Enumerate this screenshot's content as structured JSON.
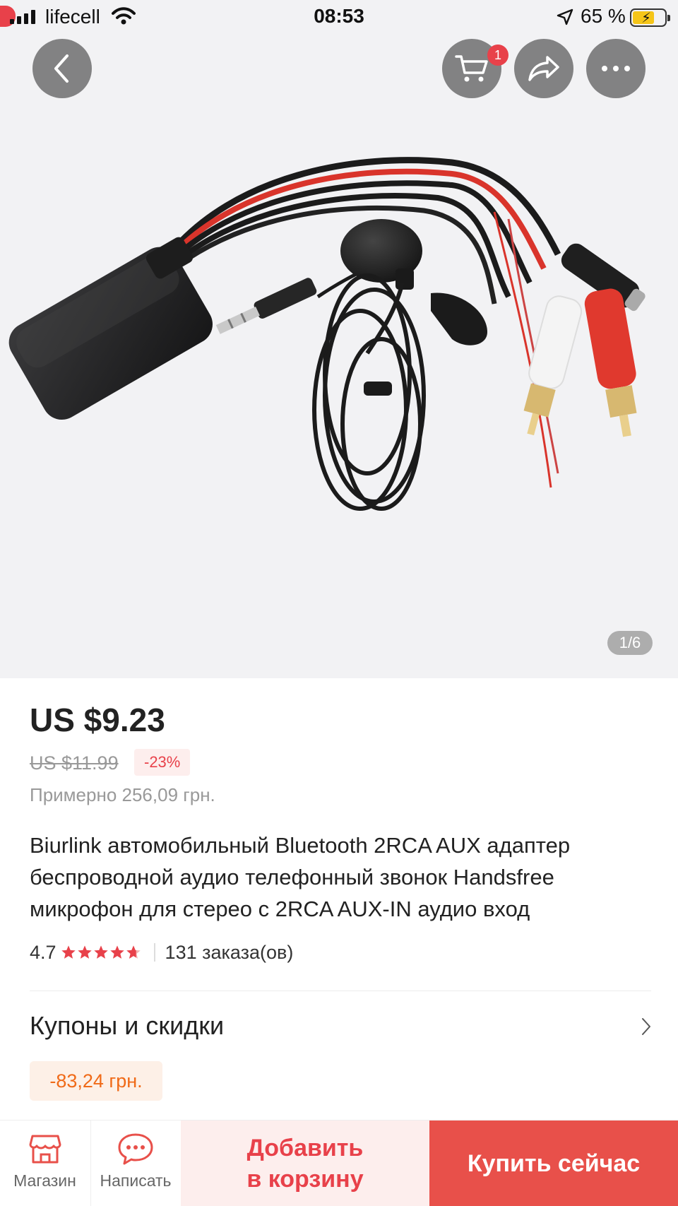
{
  "status_bar": {
    "carrier": "lifecell",
    "time": "08:53",
    "battery_percent": "65 %",
    "battery_level": 0.65,
    "icons": [
      "signal-icon",
      "wifi-icon",
      "location-arrow-icon",
      "battery-charging-icon"
    ]
  },
  "gallery": {
    "page_indicator": "1/6",
    "cart_count": "1",
    "icons": [
      "back-icon",
      "cart-icon",
      "share-icon",
      "more-icon"
    ]
  },
  "product": {
    "price": "US $9.23",
    "original_price": "US $11.99",
    "discount": "-23%",
    "approx_price": "Примерно 256,09 грн.",
    "title": "Biurlink автомобильный Bluetooth 2RCA AUX адаптер беспроводной аудио телефонный звонок Handsfree микрофон для стерео с 2RCA AUX-IN аудио вход",
    "rating": "4.7",
    "rating_value": 4.7,
    "rating_max": 5,
    "orders": "131 заказа(ов)"
  },
  "coupons": {
    "title": "Купоны и скидки",
    "coupon_value": "-83,24 грн."
  },
  "bottom_bar": {
    "store_label": "Магазин",
    "chat_label": "Написать",
    "add_to_cart_line1": "Добавить",
    "add_to_cart_line2": "в корзину",
    "buy_now_label": "Купить сейчас"
  },
  "colors": {
    "accent": "#e8504a",
    "badge": "#e8414a",
    "coupon_text": "#f06a18",
    "coupon_bg": "#fdf0e7",
    "add_to_cart_bg": "#fdeeed"
  }
}
